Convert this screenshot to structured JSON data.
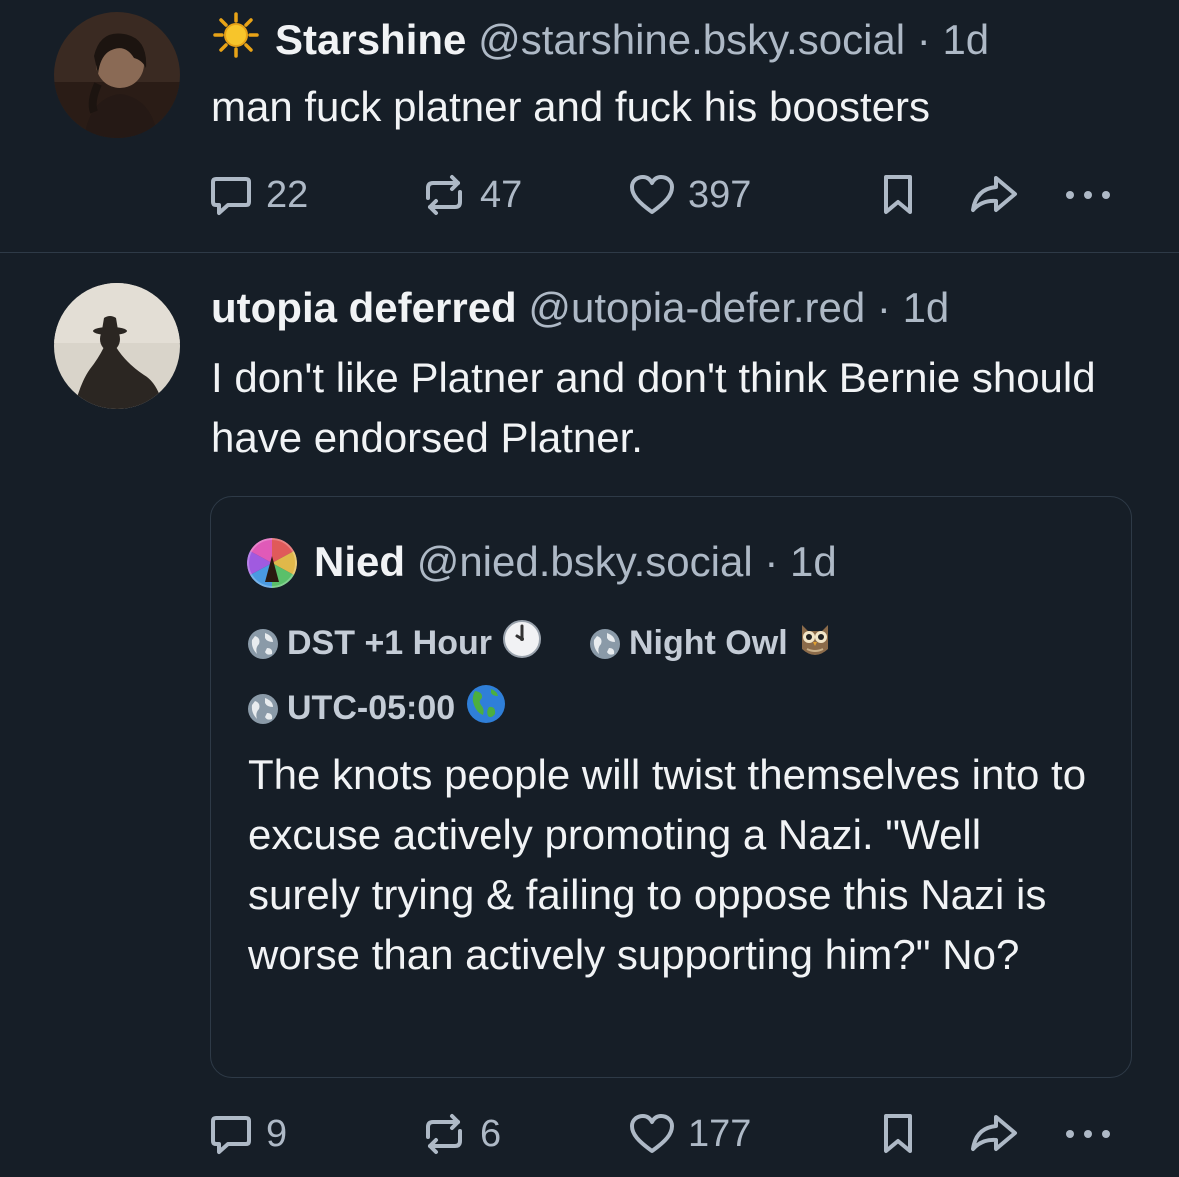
{
  "posts": [
    {
      "author": {
        "name": "Starshine",
        "handle": "@starshine.bsky.social",
        "time": "1d",
        "name_icon": "sun-emoji"
      },
      "text": "man fuck platner and fuck his boosters",
      "actions": {
        "replies": "22",
        "reposts": "47",
        "likes": "397"
      }
    },
    {
      "author": {
        "name": "utopia deferred",
        "handle": "@utopia-defer.red",
        "time": "1d"
      },
      "text": "I don't like Platner and don't think Bernie should have endorsed Platner.",
      "actions": {
        "replies": "9",
        "reposts": "6",
        "likes": "177"
      },
      "quote": {
        "author": {
          "name": "Nied",
          "handle": "@nied.bsky.social",
          "time": "1d"
        },
        "badges": [
          {
            "label": "DST +1 Hour",
            "icon": "clock-emoji"
          },
          {
            "label": "Night Owl",
            "icon": "owl-emoji"
          },
          {
            "label": "UTC-05:00",
            "icon": "earth-americas-emoji"
          }
        ],
        "text": "The knots people will twist themselves into to excuse actively promoting a Nazi. \"Well surely trying & failing to oppose this Nazi is worse than actively supporting him?\" No?"
      }
    }
  ],
  "separator": "·",
  "colors": {
    "background": "#161e27",
    "text_primary": "#f1f3f5",
    "text_secondary": "#aeb9c6",
    "border": "#2e3a47"
  }
}
